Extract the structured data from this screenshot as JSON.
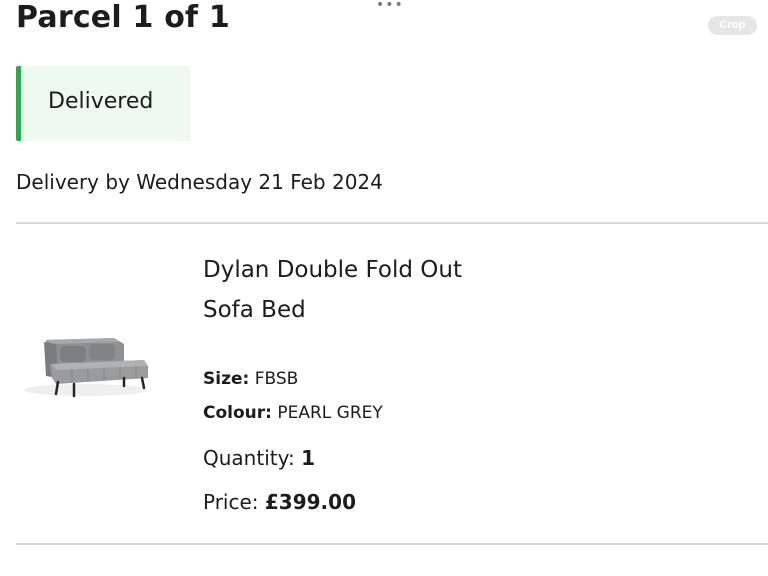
{
  "header": {
    "title": "Parcel 1 of 1",
    "crop_label": "Crop"
  },
  "status": {
    "label": "Delivered",
    "accent_color": "#2fa84f",
    "background_color": "#eefaef"
  },
  "delivery": {
    "text": "Delivery by Wednesday 21 Feb 2024"
  },
  "product": {
    "name_line1": "Dylan Double Fold Out",
    "name_line2": "Sofa Bed",
    "size_label": "Size:",
    "size_value": "FBSB",
    "colour_label": "Colour:",
    "colour_value": "PEARL GREY",
    "quantity_label": "Quantity:",
    "quantity_value": "1",
    "price_label": "Price:",
    "price_value": "£399.00",
    "image_icon": "sofa-bed-image"
  }
}
